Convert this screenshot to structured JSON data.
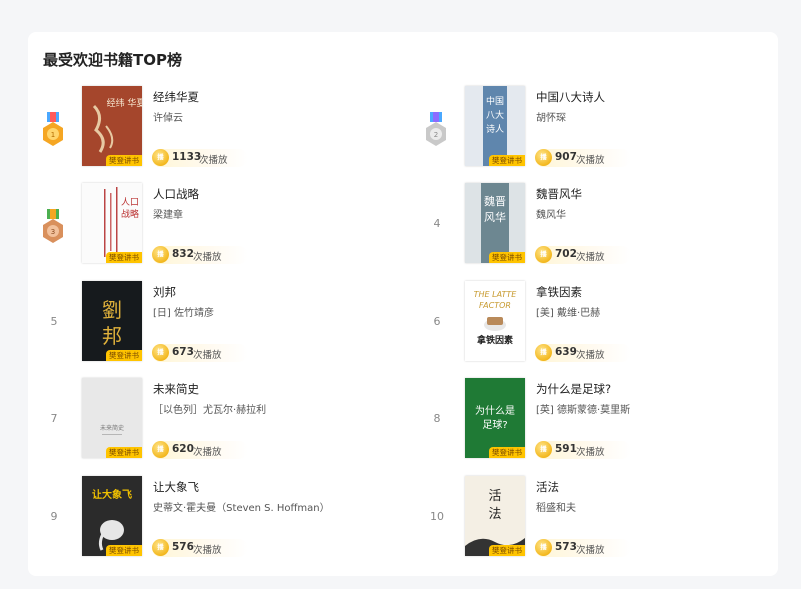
{
  "section": {
    "title": "最受欢迎书籍TOP榜"
  },
  "badge_label": "樊登讲书",
  "coin_label": "播",
  "play_unit": "次播放",
  "colors": {
    "badge": "#ffc400",
    "coin": "#f3b81f",
    "medal_gold": "#f5a623",
    "medal_silver": "#c9c9c9",
    "medal_bronze": "#d9905c"
  },
  "books": [
    {
      "rank": "1",
      "medal": "gold-medal-icon",
      "title": "经纬华夏",
      "author": "许倬云",
      "plays": "1133"
    },
    {
      "rank": "2",
      "medal": "silver-medal-icon",
      "title": "中国八大诗人",
      "author": "胡怀琛",
      "plays": "907"
    },
    {
      "rank": "3",
      "medal": "bronze-medal-icon",
      "title": "人口战略",
      "author": "梁建章",
      "plays": "832"
    },
    {
      "rank": "4",
      "title": "魏晋风华",
      "author": "魏风华",
      "plays": "702"
    },
    {
      "rank": "5",
      "title": "刘邦",
      "author": "[日] 佐竹靖彦",
      "plays": "673"
    },
    {
      "rank": "6",
      "title": "拿铁因素",
      "author": "[美] 戴维·巴赫",
      "plays": "639"
    },
    {
      "rank": "7",
      "title": "未来简史",
      "author": "［以色列］尤瓦尔·赫拉利",
      "plays": "620"
    },
    {
      "rank": "8",
      "title": "为什么是足球?",
      "author": "[英] 德斯蒙德·莫里斯",
      "plays": "591"
    },
    {
      "rank": "9",
      "title": "让大象飞",
      "author": "史蒂文·霍夫曼（Steven S. Hoffman）",
      "plays": "576"
    },
    {
      "rank": "10",
      "title": "活法",
      "author": "稻盛和夫",
      "plays": "573"
    }
  ],
  "covers": [
    {
      "text": "经纬 华夏"
    },
    {
      "text": "中国八大诗人"
    },
    {
      "text": "人口战略"
    },
    {
      "text": "魏晋风华"
    },
    {
      "text": "劉邦"
    },
    {
      "text": "THE LATTE FACTOR 拿铁因素"
    },
    {
      "text": "未来简史"
    },
    {
      "text": "为什么是足球?"
    },
    {
      "text": "让大象飞"
    },
    {
      "text": "活法"
    }
  ]
}
